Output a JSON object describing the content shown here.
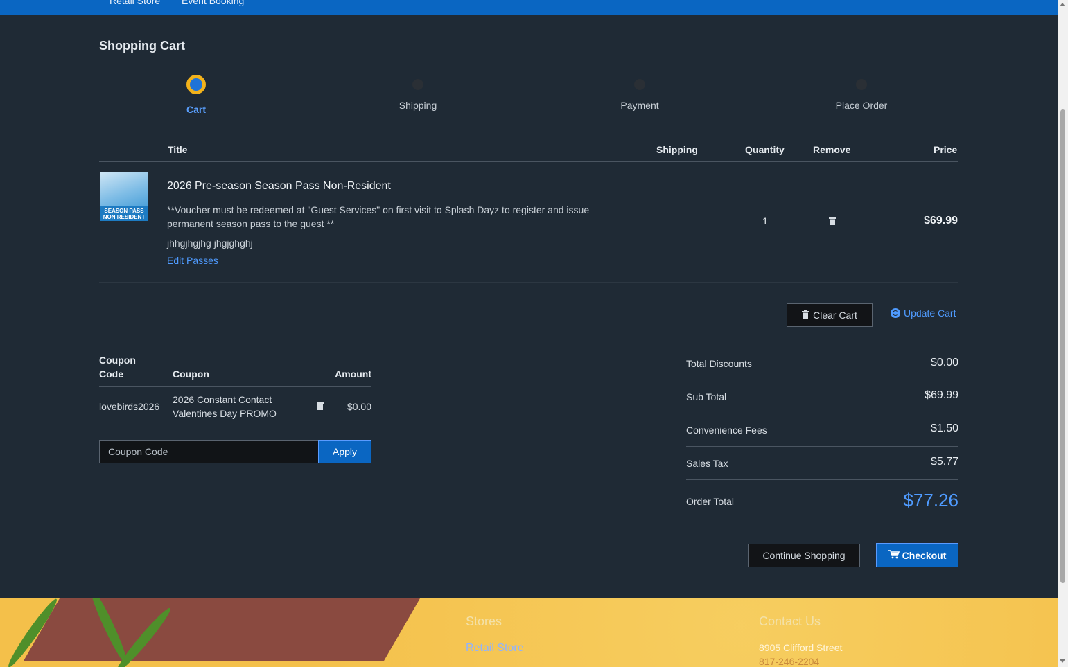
{
  "nav": {
    "links": [
      "Retail Store",
      "Event Booking"
    ]
  },
  "page": {
    "title": "Shopping Cart"
  },
  "steps": [
    {
      "label": "Cart",
      "active": true
    },
    {
      "label": "Shipping",
      "active": false
    },
    {
      "label": "Payment",
      "active": false
    },
    {
      "label": "Place Order",
      "active": false
    }
  ],
  "cart": {
    "headers": {
      "title": "Title",
      "shipping": "Shipping",
      "quantity": "Quantity",
      "remove": "Remove",
      "price": "Price"
    },
    "items": [
      {
        "thumb_text": "SEASON PASS NON RESIDENT",
        "title": "2026 Pre-season Season Pass Non-Resident",
        "description": "**Voucher must be redeemed at \"Guest Services\" on first visit to Splash Dayz to register and issue permanent season pass to the guest **",
        "note": "jhhgjhgjhg jhgjghghj",
        "edit_link": "Edit Passes",
        "quantity": "1",
        "price": "$69.99"
      }
    ],
    "clear_label": "Clear Cart",
    "update_label": "Update Cart"
  },
  "coupons": {
    "headers": {
      "code": "Coupon Code",
      "coupon": "Coupon",
      "amount": "Amount"
    },
    "rows": [
      {
        "code": "lovebirds2026",
        "coupon": "2026 Constant Contact Valentines Day PROMO",
        "amount": "$0.00"
      }
    ],
    "input_placeholder": "Coupon Code",
    "apply_label": "Apply"
  },
  "summary": {
    "rows": [
      {
        "label": "Total Discounts",
        "value": "$0.00"
      },
      {
        "label": "Sub Total",
        "value": "$69.99"
      },
      {
        "label": "Convenience Fees",
        "value": "$1.50"
      },
      {
        "label": "Sales Tax",
        "value": "$5.77"
      }
    ],
    "total_label": "Order Total",
    "total_value": "$77.26"
  },
  "actions": {
    "continue_label": "Continue Shopping",
    "checkout_label": "Checkout"
  },
  "footer": {
    "stores_heading": "Stores",
    "stores_link": "Retail Store",
    "contact_heading": "Contact Us",
    "address": "8905 Clifford Street",
    "phone": "817-246-2204"
  },
  "colors": {
    "accent": "#0a66c2",
    "link": "#4f9bff",
    "step_ring": "#f2b21b",
    "background": "#1f2a35"
  }
}
